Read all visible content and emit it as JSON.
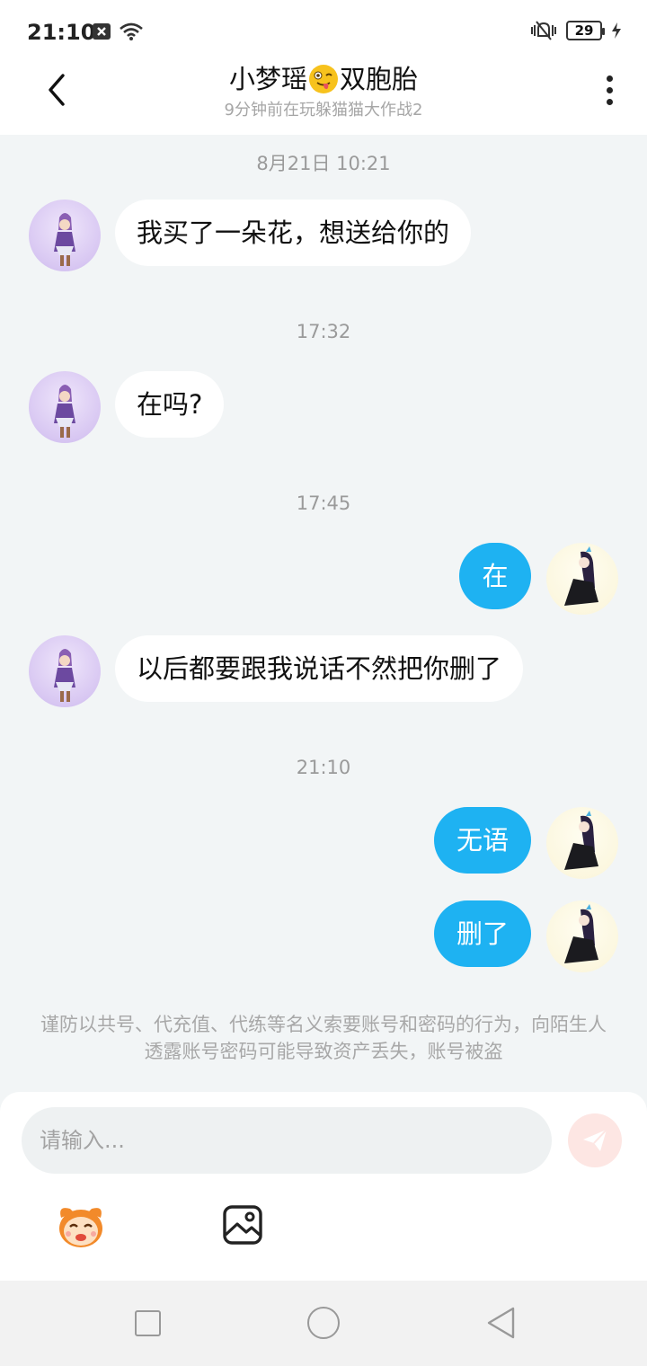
{
  "status_bar": {
    "time": "21:10",
    "battery": "29",
    "icons": [
      "notification-x-icon",
      "wifi-icon",
      "vibrate-icon",
      "battery-icon",
      "charging-icon"
    ]
  },
  "header": {
    "title_prefix": "小梦瑶",
    "title_suffix": "双胞胎",
    "subtitle": "9分钟前在玩躲猫猫大作战2"
  },
  "messages": {
    "t1": "8月21日 10:21",
    "m1": "我买了一朵花，想送给你的",
    "t2": "17:32",
    "m2": "在吗?",
    "t3": "17:45",
    "m3": "在",
    "m4": "以后都要跟我说话不然把你删了",
    "t4": "21:10",
    "m5": "无语",
    "m6": "删了"
  },
  "warning_text": "谨防以共号、代充值、代练等名义索要账号和密码的行为，向陌生人透露账号密码可能导致资产丢失，账号被盗",
  "input": {
    "placeholder": "请输入..."
  },
  "colors": {
    "outgoing_bubble": "#1eb2f2",
    "incoming_bubble": "#ffffff",
    "chat_background": "#f2f5f6",
    "send_button": "#fde6e3"
  }
}
